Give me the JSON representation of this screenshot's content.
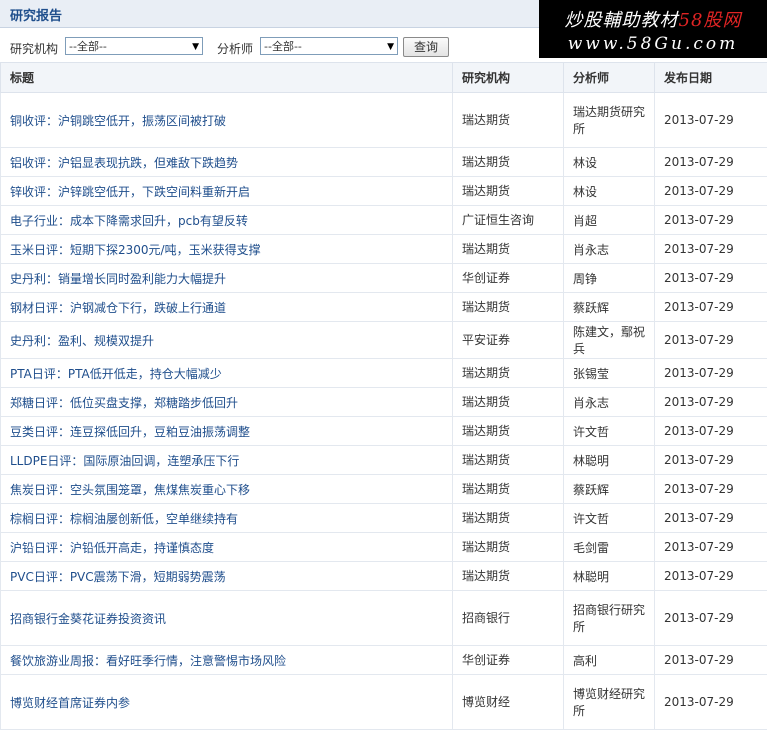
{
  "page_title": "研究报告",
  "watermark": {
    "line1_prefix": "炒股輔助教材",
    "line1_brand": "58股网",
    "line2": "www.58Gu.com"
  },
  "filters": {
    "org_label": "研究机构",
    "org_value": "--全部--",
    "analyst_label": "分析师",
    "analyst_value": "--全部--",
    "query_button": "查询"
  },
  "table": {
    "headers": [
      "标题",
      "研究机构",
      "分析师",
      "发布日期"
    ],
    "rows": [
      {
        "title": "铜收评：沪铜跳空低开，振荡区间被打破",
        "org": "瑞达期货",
        "analyst": "瑞达期货研究所",
        "date": "2013-07-29"
      },
      {
        "title": "铝收评：沪铝显表现抗跌，但难敌下跌趋势",
        "org": "瑞达期货",
        "analyst": "林设",
        "date": "2013-07-29"
      },
      {
        "title": "锌收评：沪锌跳空低开，下跌空间料重新开启",
        "org": "瑞达期货",
        "analyst": "林设",
        "date": "2013-07-29"
      },
      {
        "title": "电子行业：成本下降需求回升，pcb有望反转",
        "org": "广证恒生咨询",
        "analyst": "肖超",
        "date": "2013-07-29"
      },
      {
        "title": "玉米日评：短期下探2300元/吨，玉米获得支撑",
        "org": "瑞达期货",
        "analyst": "肖永志",
        "date": "2013-07-29"
      },
      {
        "title": "史丹利：销量增长同时盈利能力大幅提升",
        "org": "华创证券",
        "analyst": "周铮",
        "date": "2013-07-29"
      },
      {
        "title": "钢材日评：沪钢减仓下行，跌破上行通道",
        "org": "瑞达期货",
        "analyst": "蔡跃辉",
        "date": "2013-07-29"
      },
      {
        "title": "史丹利：盈利、规模双提升",
        "org": "平安证券",
        "analyst": "陈建文，鄢祝兵",
        "date": "2013-07-29"
      },
      {
        "title": "PTA日评：PTA低开低走，持仓大幅减少",
        "org": "瑞达期货",
        "analyst": "张锡莹",
        "date": "2013-07-29"
      },
      {
        "title": "郑糖日评：低位买盘支撑，郑糖踏步低回升",
        "org": "瑞达期货",
        "analyst": "肖永志",
        "date": "2013-07-29"
      },
      {
        "title": "豆类日评：连豆探低回升，豆粕豆油振荡调整",
        "org": "瑞达期货",
        "analyst": "许文哲",
        "date": "2013-07-29"
      },
      {
        "title": "LLDPE日评：国际原油回调，连塑承压下行",
        "org": "瑞达期货",
        "analyst": "林聪明",
        "date": "2013-07-29"
      },
      {
        "title": "焦炭日评：空头氛围笼罩，焦煤焦炭重心下移",
        "org": "瑞达期货",
        "analyst": "蔡跃辉",
        "date": "2013-07-29"
      },
      {
        "title": "棕榈日评：棕榈油屡创新低，空单继续持有",
        "org": "瑞达期货",
        "analyst": "许文哲",
        "date": "2013-07-29"
      },
      {
        "title": "沪铅日评：沪铅低开高走，持谨慎态度",
        "org": "瑞达期货",
        "analyst": "毛剑雷",
        "date": "2013-07-29"
      },
      {
        "title": "PVC日评：PVC震荡下滑，短期弱势震荡",
        "org": "瑞达期货",
        "analyst": "林聪明",
        "date": "2013-07-29"
      },
      {
        "title": "招商银行金葵花证券投资资讯",
        "org": "招商银行",
        "analyst": "招商银行研究所",
        "date": "2013-07-29"
      },
      {
        "title": "餐饮旅游业周报：看好旺季行情，注意警惕市场风险",
        "org": "华创证券",
        "analyst": "高利",
        "date": "2013-07-29"
      },
      {
        "title": "博览财经首席证券内参",
        "org": "博览财经",
        "analyst": "博览财经研究所",
        "date": "2013-07-29"
      }
    ]
  }
}
